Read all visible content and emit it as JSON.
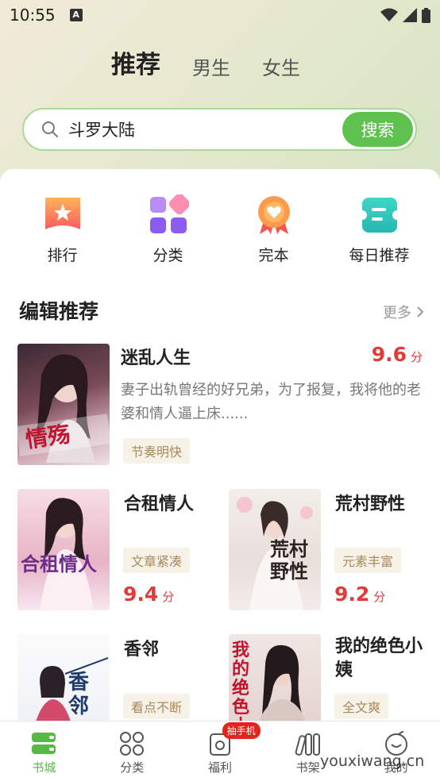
{
  "status": {
    "time": "10:55",
    "app_indicator": "A"
  },
  "tabs": [
    {
      "label": "推荐",
      "active": true
    },
    {
      "label": "男生",
      "active": false
    },
    {
      "label": "女生",
      "active": false
    }
  ],
  "search": {
    "value": "斗罗大陆",
    "button": "搜索"
  },
  "quick": [
    {
      "label": "排行",
      "icon": "ranking-icon"
    },
    {
      "label": "分类",
      "icon": "category-icon"
    },
    {
      "label": "完本",
      "icon": "completed-icon"
    },
    {
      "label": "每日推荐",
      "icon": "daily-recommend-icon"
    }
  ],
  "section": {
    "title": "编辑推荐",
    "more": "更多"
  },
  "featured": {
    "title": "迷乱人生",
    "score": "9.6",
    "score_unit": "分",
    "desc": "妻子出轨曾经的好兄弟，为了报复，我将他的老婆和情人逼上床......",
    "tag": "节奏明快",
    "cover_text": "情殇"
  },
  "books": [
    {
      "title": "合租情人",
      "tag": "文章紧凑",
      "score": "9.4",
      "unit": "分",
      "cover_text": "合租情人"
    },
    {
      "title": "荒村野性",
      "tag": "元素丰富",
      "score": "9.2",
      "unit": "分",
      "cover_text": "荒村野性"
    },
    {
      "title": "香邻",
      "tag": "看点不断",
      "cover_text": "香邻"
    },
    {
      "title": "我的绝色小姨",
      "tag": "全文爽",
      "cover_text": "我的绝色小姨"
    }
  ],
  "nav": [
    {
      "label": "书城",
      "active": true
    },
    {
      "label": "分类"
    },
    {
      "label": "福利",
      "badge": "抽手机"
    },
    {
      "label": "书架"
    },
    {
      "label": "我的"
    }
  ],
  "watermark": "youxiwang.cn",
  "colors": {
    "accent": "#5fc24e",
    "score": "#e33a3a",
    "search_border": "#a9d99b"
  }
}
